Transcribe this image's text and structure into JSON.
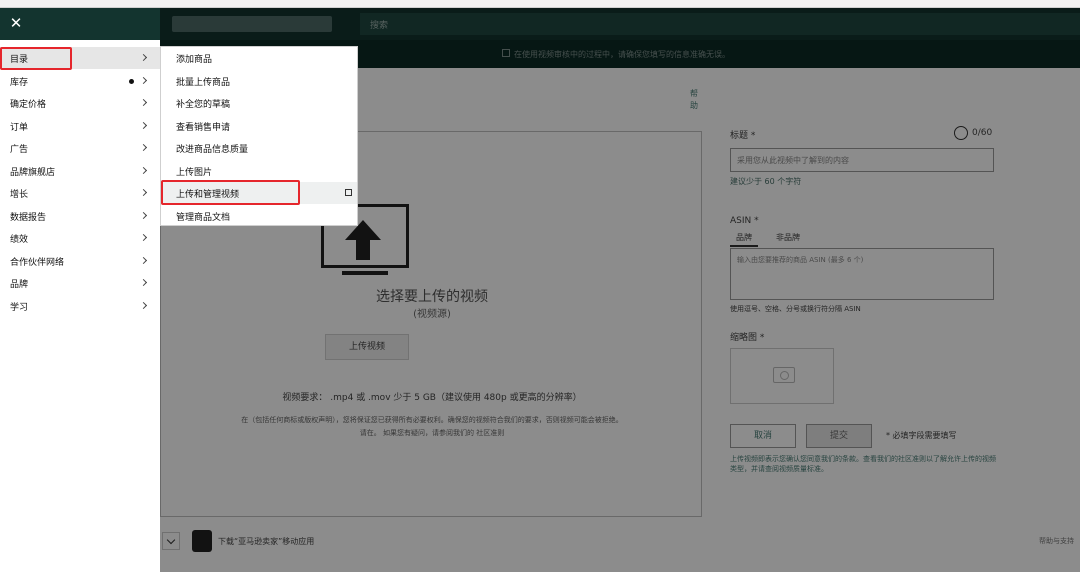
{
  "topbar": {
    "search_label": "搜索",
    "notice": "在使用视频审核中的过程中，请确保您填写的信息准确无误。"
  },
  "help_link": "帮助",
  "upload": {
    "title": "选择要上传的视频",
    "subtitle": "(视频源)",
    "button": "上传视频",
    "requirements": "视频要求：  .mp4 或 .mov   少于 5 GB（建议使用 480p 或更高的分辨率）",
    "note": "在（包括任何商标或版权声明），您将保证您已获得所有必要权利。确保您的视频符合我们的要求，否则视频可能会被拒绝。",
    "note2": "请在。   如果您有疑问，请参阅我们的 社区准则"
  },
  "form": {
    "title_label": "标题 *",
    "title_counter": "0/60",
    "title_placeholder": "采用您从此视频中了解到的内容",
    "title_hint": "建议少于 60 个字符",
    "asin_label": "ASIN *",
    "asin_tab_brand": "品牌",
    "asin_tab_nonbrand": "非品牌",
    "asin_placeholder": "输入由您要推荐的商品 ASIN (最多 6 个)",
    "asin_hint": "使用逗号、空格、分号或换行符分隔 ASIN",
    "thumb_label": "缩略图 *",
    "cancel": "取消",
    "submit": "提交",
    "required_note": "* 必填字段需要填写",
    "terms_note": "上传视频即表示您确认您同意我们的条款。查看我们的社区准则以了解允许上传的视频类型，并请查阅视频质量标准。"
  },
  "footer": {
    "app_text": "下载“亚马逊卖家”移动应用",
    "right_text": "帮助与支持"
  },
  "sidebar": {
    "items": [
      {
        "label": "目录",
        "dot": false
      },
      {
        "label": "库存",
        "dot": true
      },
      {
        "label": "确定价格",
        "dot": false
      },
      {
        "label": "订单",
        "dot": false
      },
      {
        "label": "广告",
        "dot": false
      },
      {
        "label": "品牌旗舰店",
        "dot": false
      },
      {
        "label": "增长",
        "dot": false
      },
      {
        "label": "数据报告",
        "dot": false
      },
      {
        "label": "绩效",
        "dot": false
      },
      {
        "label": "合作伙伴网络",
        "dot": false
      },
      {
        "label": "品牌",
        "dot": false
      },
      {
        "label": "学习",
        "dot": false
      }
    ]
  },
  "submenu": {
    "items": [
      {
        "label": "添加商品",
        "external": false
      },
      {
        "label": "批量上传商品",
        "external": false
      },
      {
        "label": "补全您的草稿",
        "external": false
      },
      {
        "label": "查看销售申请",
        "external": false
      },
      {
        "label": "改进商品信息质量",
        "external": false
      },
      {
        "label": "上传图片",
        "external": false
      },
      {
        "label": "上传和管理视频",
        "external": true
      },
      {
        "label": "管理商品文档",
        "external": false
      }
    ]
  },
  "colors": {
    "topbar": "#13342f",
    "highlight": "#e5262c",
    "link": "#4a7d76"
  }
}
